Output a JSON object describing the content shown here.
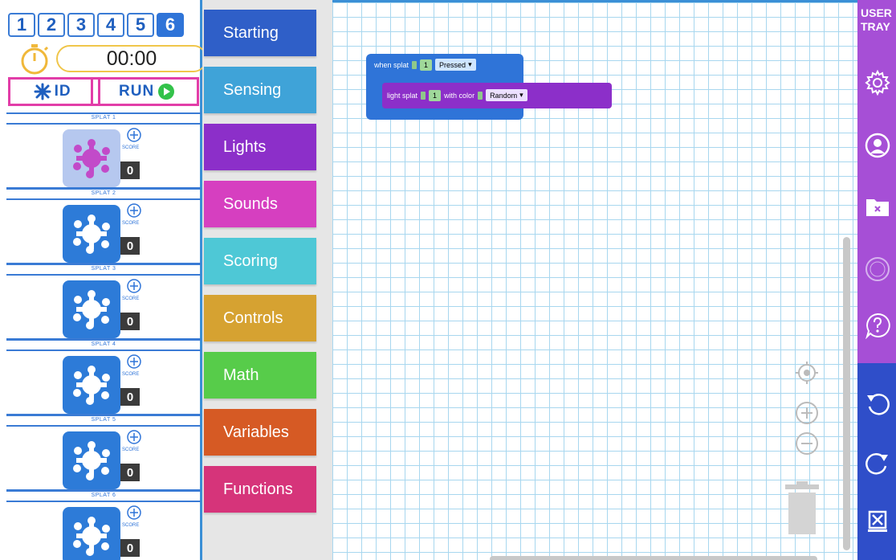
{
  "tabs": [
    {
      "label": "1",
      "active": false
    },
    {
      "label": "2",
      "active": false
    },
    {
      "label": "3",
      "active": false
    },
    {
      "label": "4",
      "active": false
    },
    {
      "label": "5",
      "active": false
    },
    {
      "label": "6",
      "active": true
    }
  ],
  "timer": {
    "value": "00:00"
  },
  "controls": {
    "id_label": "ID",
    "run_label": "RUN"
  },
  "splats": [
    {
      "label": "SPLAT 1",
      "score_label": "SCORE",
      "score": "0",
      "thumb": "pink"
    },
    {
      "label": "SPLAT 2",
      "score_label": "SCORE",
      "score": "0",
      "thumb": "blue"
    },
    {
      "label": "SPLAT 3",
      "score_label": "SCORE",
      "score": "0",
      "thumb": "blue"
    },
    {
      "label": "SPLAT 4",
      "score_label": "SCORE",
      "score": "0",
      "thumb": "blue"
    },
    {
      "label": "SPLAT 5",
      "score_label": "SCORE",
      "score": "0",
      "thumb": "blue"
    },
    {
      "label": "SPLAT 6",
      "score_label": "SCORE",
      "score": "0",
      "thumb": "blue"
    }
  ],
  "categories": [
    {
      "label": "Starting",
      "color": "#2f5fc8"
    },
    {
      "label": "Sensing",
      "color": "#3fa3d8"
    },
    {
      "label": "Lights",
      "color": "#8c2fc9"
    },
    {
      "label": "Sounds",
      "color": "#d63fc0"
    },
    {
      "label": "Scoring",
      "color": "#4ec8d6"
    },
    {
      "label": "Controls",
      "color": "#d6a231"
    },
    {
      "label": "Math",
      "color": "#57cc4a"
    },
    {
      "label": "Variables",
      "color": "#d65a24"
    },
    {
      "label": "Functions",
      "color": "#d6347a"
    }
  ],
  "blocks": {
    "when": {
      "prefix": "when splat",
      "number": "1",
      "event": "Pressed"
    },
    "light": {
      "prefix": "light splat",
      "number": "1",
      "middle": "with color",
      "color": "Random"
    }
  },
  "tray": {
    "label": "USER TRAY"
  }
}
